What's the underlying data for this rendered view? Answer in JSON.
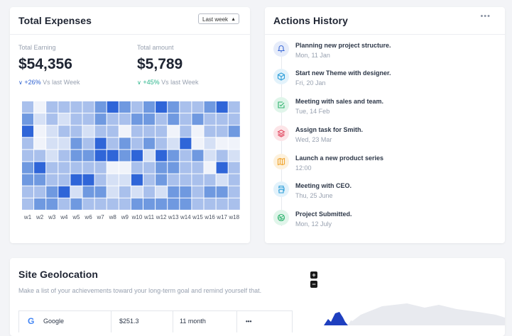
{
  "expenses": {
    "title": "Total Expenses",
    "period_select": "Last week",
    "earning": {
      "label": "Total Earning",
      "value": "$54,356",
      "delta": "+26%",
      "delta_suffix": "Vs last Week"
    },
    "amount": {
      "label": "Total amount",
      "value": "$5,789",
      "delta": "+45%",
      "delta_suffix": "Vs last Week"
    },
    "heatmap": {
      "type": "heatmap",
      "columns": [
        "w1",
        "w2",
        "w3",
        "w4",
        "w5",
        "w6",
        "w7",
        "w8",
        "w9",
        "w10",
        "w11",
        "w12",
        "w13",
        "w14",
        "w15",
        "w16",
        "w17",
        "w18"
      ],
      "rows": 9,
      "levels": [
        [
          2,
          0,
          2,
          2,
          2,
          2,
          3,
          4,
          3,
          2,
          3,
          4,
          3,
          2,
          2,
          3,
          4,
          2
        ],
        [
          3,
          1,
          2,
          1,
          2,
          2,
          3,
          2,
          2,
          3,
          3,
          2,
          3,
          2,
          3,
          2,
          2,
          2
        ],
        [
          4,
          0,
          1,
          2,
          2,
          1,
          2,
          2,
          0,
          2,
          2,
          2,
          0,
          2,
          0,
          2,
          2,
          3
        ],
        [
          2,
          0,
          1,
          1,
          3,
          2,
          4,
          2,
          3,
          2,
          3,
          2,
          1,
          4,
          0,
          1,
          0,
          0
        ],
        [
          2,
          2,
          1,
          2,
          3,
          3,
          4,
          4,
          3,
          4,
          1,
          4,
          3,
          2,
          3,
          1,
          2,
          1
        ],
        [
          3,
          4,
          2,
          2,
          2,
          2,
          2,
          0,
          0,
          2,
          2,
          3,
          3,
          2,
          2,
          0,
          4,
          2
        ],
        [
          3,
          3,
          2,
          2,
          4,
          4,
          2,
          1,
          1,
          4,
          2,
          3,
          2,
          2,
          2,
          2,
          1,
          2
        ],
        [
          2,
          2,
          3,
          4,
          1,
          3,
          3,
          1,
          2,
          1,
          2,
          1,
          3,
          3,
          2,
          3,
          3,
          2
        ],
        [
          2,
          3,
          3,
          2,
          3,
          2,
          2,
          2,
          2,
          3,
          3,
          3,
          3,
          3,
          2,
          2,
          2,
          2
        ]
      ],
      "colors": [
        "#f0f3fa",
        "#d5e0f5",
        "#a9c0ec",
        "#6f99e0",
        "#2f65d8"
      ]
    }
  },
  "actions": {
    "title": "Actions History",
    "more_icon": "more-dots-icon",
    "items": [
      {
        "title": "Planning new project structure.",
        "date": "Mon, 11 Jan",
        "icon": "bell-icon",
        "color": "#3d6ad6",
        "bg": "#e6ecfa"
      },
      {
        "title": "Start new Theme with designer.",
        "date": "Fri, 20 Jan",
        "icon": "cube-icon",
        "color": "#2f9fd9",
        "bg": "#e2f2fb"
      },
      {
        "title": "Meeting with sales and team.",
        "date": "Tue, 14 Feb",
        "icon": "check-square-icon",
        "color": "#2fb36e",
        "bg": "#e0f5ea"
      },
      {
        "title": "Assign task for Smith.",
        "date": "Wed, 23 Mar",
        "icon": "layers-icon",
        "color": "#e0465e",
        "bg": "#fce4e7"
      },
      {
        "title": "Launch a new product series",
        "date": "12:00",
        "icon": "map-icon",
        "color": "#f0a531",
        "bg": "#fdf1dc"
      },
      {
        "title": "Meeting with CEO.",
        "date": "Thu, 25 June",
        "icon": "printer-icon",
        "color": "#2f9fd9",
        "bg": "#e2f2fb"
      },
      {
        "title": "Project Submitted.",
        "date": "Mon, 12 July",
        "icon": "dribbble-icon",
        "color": "#2fb36e",
        "bg": "#e0f5ea"
      }
    ]
  },
  "geo": {
    "title": "Site Geolocation",
    "subtitle": "Make a list of your achievements toward your long-term goal and remind yourself that.",
    "row": {
      "site": "Google",
      "amount": "$251.3",
      "period": "11 month",
      "menu": "•••"
    },
    "zoom_in": "+",
    "zoom_out": "−"
  }
}
